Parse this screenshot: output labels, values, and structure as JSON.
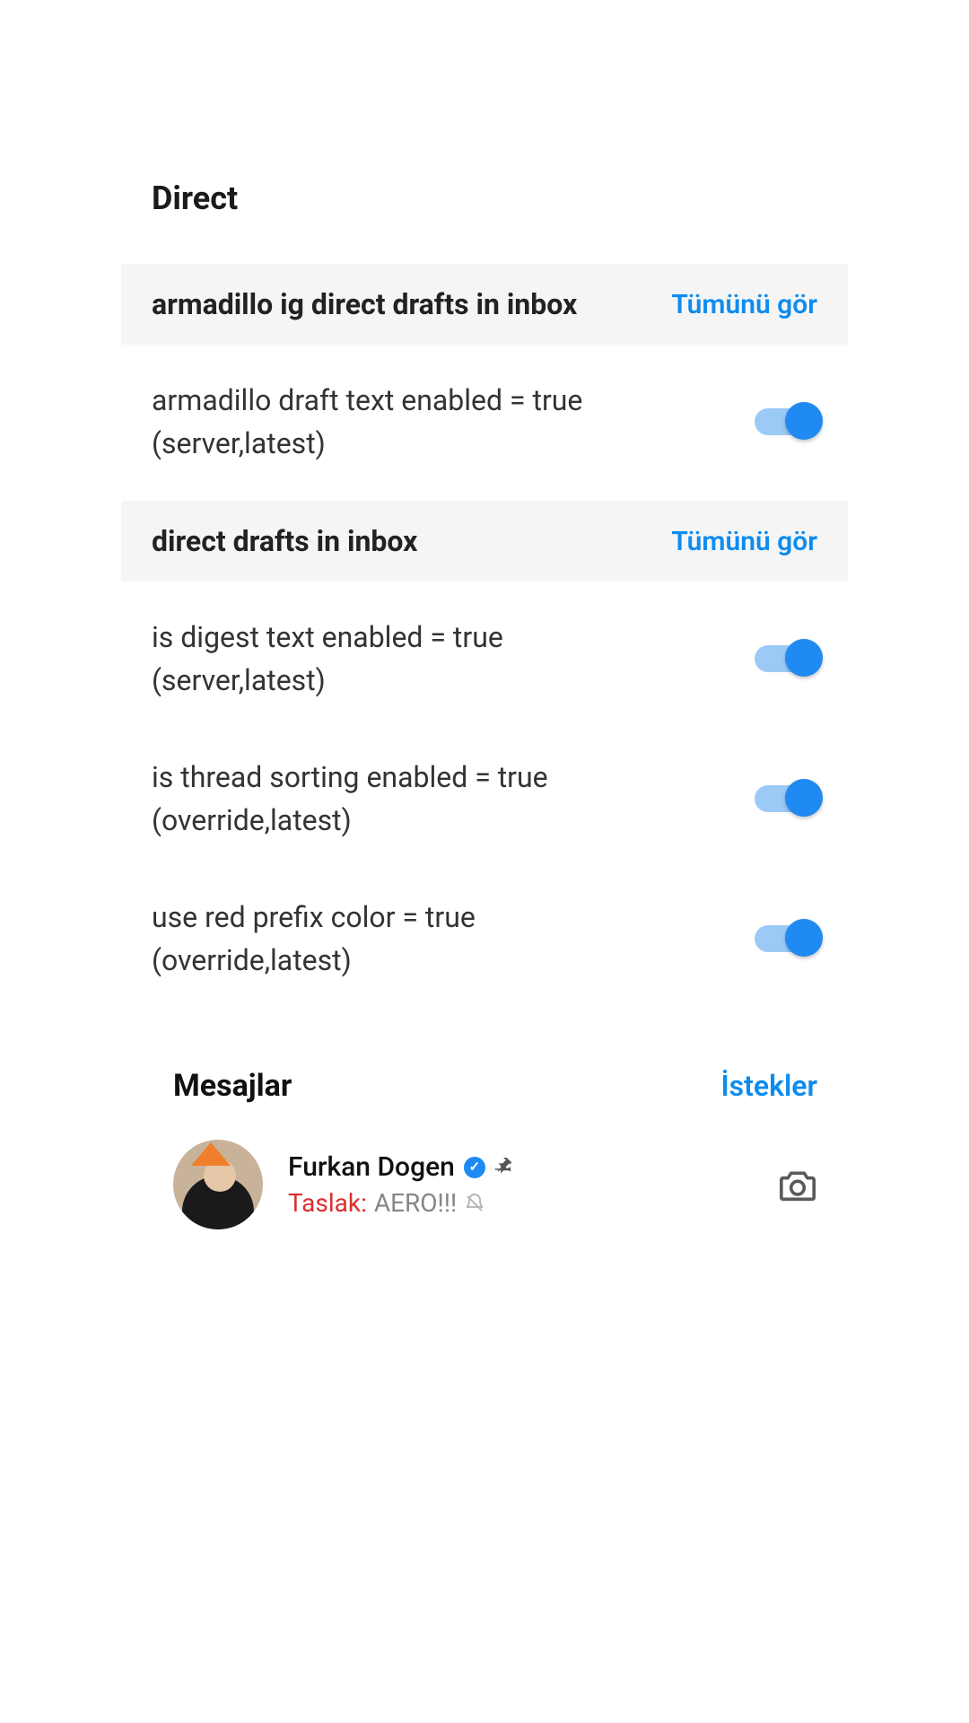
{
  "page_title": "Direct",
  "see_all_label": "Tümünü gör",
  "sections": [
    {
      "title": "armadillo ig direct drafts in inbox",
      "rows": [
        {
          "line1": "armadillo draft text enabled = true",
          "line2": "(server,latest)",
          "on": true
        }
      ]
    },
    {
      "title": "direct drafts in inbox",
      "rows": [
        {
          "line1": "is digest text enabled = true",
          "line2": "(server,latest)",
          "on": true
        },
        {
          "line1": "is thread sorting enabled = true",
          "line2": "(override,latest)",
          "on": true
        },
        {
          "line1": "use red prefix color = true",
          "line2": "(override,latest)",
          "on": true
        }
      ]
    }
  ],
  "tabs": {
    "active": "Mesajlar",
    "inactive": "İstekler"
  },
  "thread": {
    "name": "Furkan Dogen",
    "prefix": "Taslak:",
    "text": "AERO!!!",
    "verified": true,
    "pinned": true,
    "muted": true
  }
}
